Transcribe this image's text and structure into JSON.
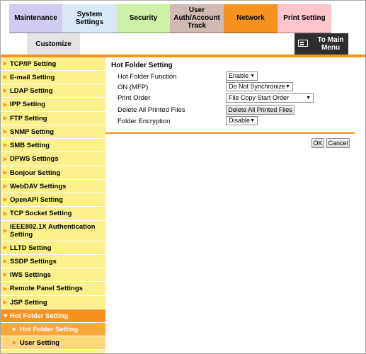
{
  "tabs": {
    "maintenance": "Maintenance",
    "system_settings": "System Settings",
    "security": "Security",
    "user_auth_line1": "User",
    "user_auth_line2": "Auth/Account",
    "user_auth_line3": "Track",
    "network": "Network",
    "print_setting": "Print Setting",
    "customize": "Customize"
  },
  "main_menu": {
    "line1": "To Main",
    "line2": "Menu",
    "icon": "menu-icon"
  },
  "sidebar": {
    "items": [
      "TCP/IP Setting",
      "E-mail Setting",
      "LDAP Setting",
      "IPP Setting",
      "FTP Setting",
      "SNMP Setting",
      "SMB Setting",
      "DPWS Settings",
      "Bonjour Setting",
      "WebDAV Settings",
      "OpenAPI Setting",
      "TCP Socket Setting",
      "IEEE802.1X Authentication Setting",
      "LLTD Setting",
      "SSDP Settings",
      "IWS Settings",
      "Remote Panel Settings",
      "JSP Setting",
      "Hot Folder Setting"
    ],
    "sub_items": [
      "Hot Folder Setting",
      "User Setting"
    ]
  },
  "content": {
    "title": "Hot Folder Setting",
    "rows": [
      {
        "label": "Hot Folder Function",
        "value": "Enable"
      },
      {
        "label": "ON (MFP)",
        "value": "Do Not Synchronize"
      },
      {
        "label": "Print Order",
        "value": "File Copy Start Order"
      },
      {
        "label": "Delete All Printed Files",
        "value": "Delete All Printed Files"
      },
      {
        "label": "Folder Encryption",
        "value": "Disable"
      }
    ],
    "ok": "OK",
    "cancel": "Cancel"
  },
  "colors": {
    "accent": "#f7921e",
    "nav_bg": "#fcf08c"
  }
}
